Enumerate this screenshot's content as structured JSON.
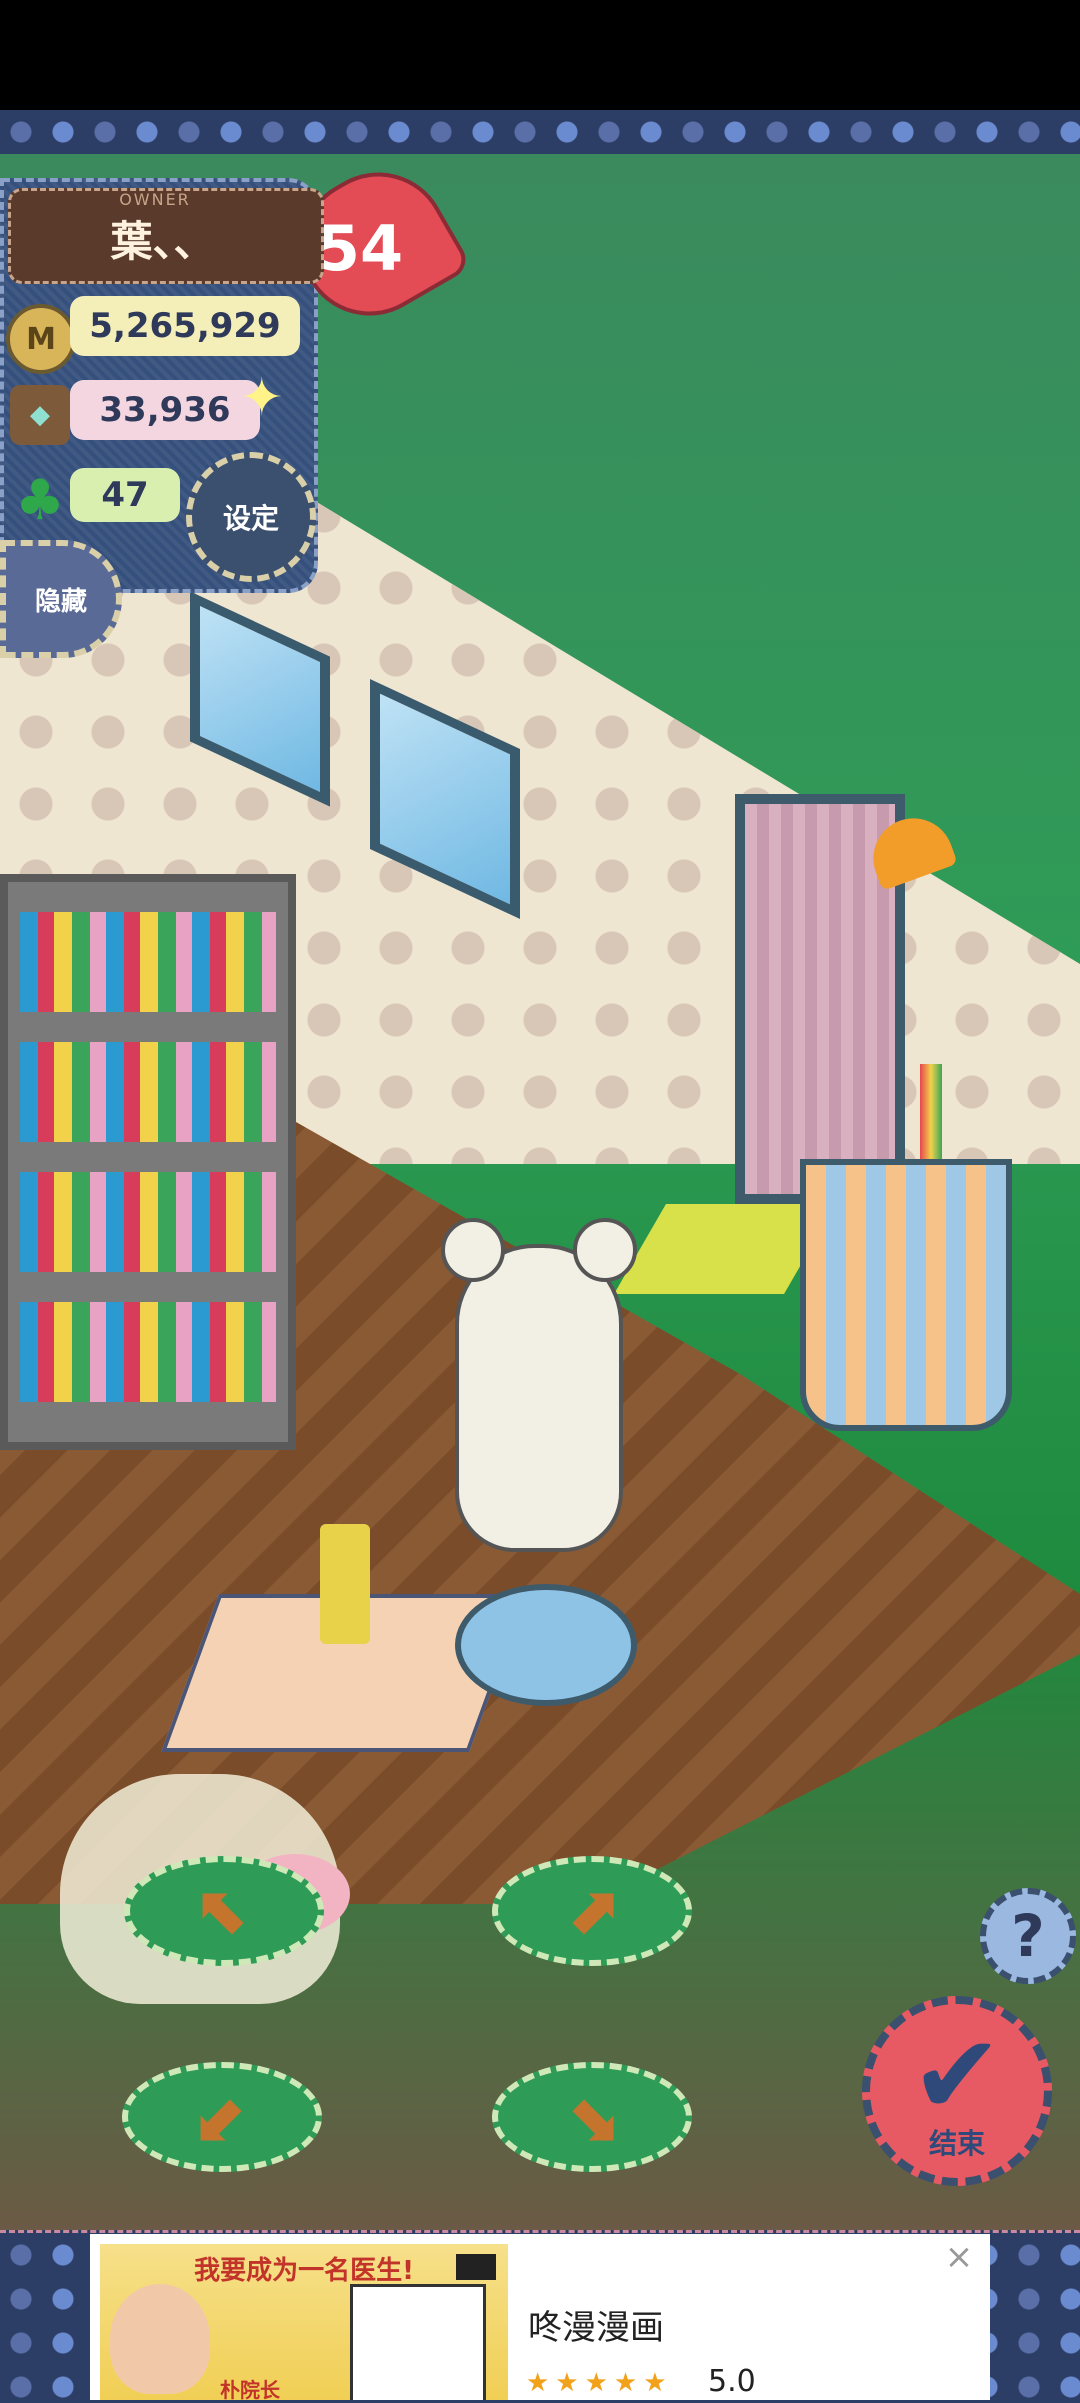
{
  "hud": {
    "owner_label": "OWNER",
    "owner_name": "葉、、",
    "hearts": "54",
    "money": "5,265,929",
    "stock": "33,936",
    "clover": "47",
    "settings_label": "设定",
    "hide_label": "隐藏",
    "money_icon_glyph": "M"
  },
  "controls": {
    "help_label": "?",
    "finish_label": "结束",
    "arrow_up_left": "⬉",
    "arrow_up_right": "⬈",
    "arrow_down_left": "⬋",
    "arrow_down_right": "⬊"
  },
  "ad": {
    "image_headline": "我要成为一名医生!",
    "image_subtitle": "朴院长",
    "title": "咚漫漫画",
    "stars": "★★★★★",
    "rating": "5.0",
    "close": "×"
  },
  "colors": {
    "hud_blue": "#35507c",
    "heart_red": "#e34b55",
    "finish_red": "#e85a63",
    "grass_green": "#2e9c56"
  }
}
